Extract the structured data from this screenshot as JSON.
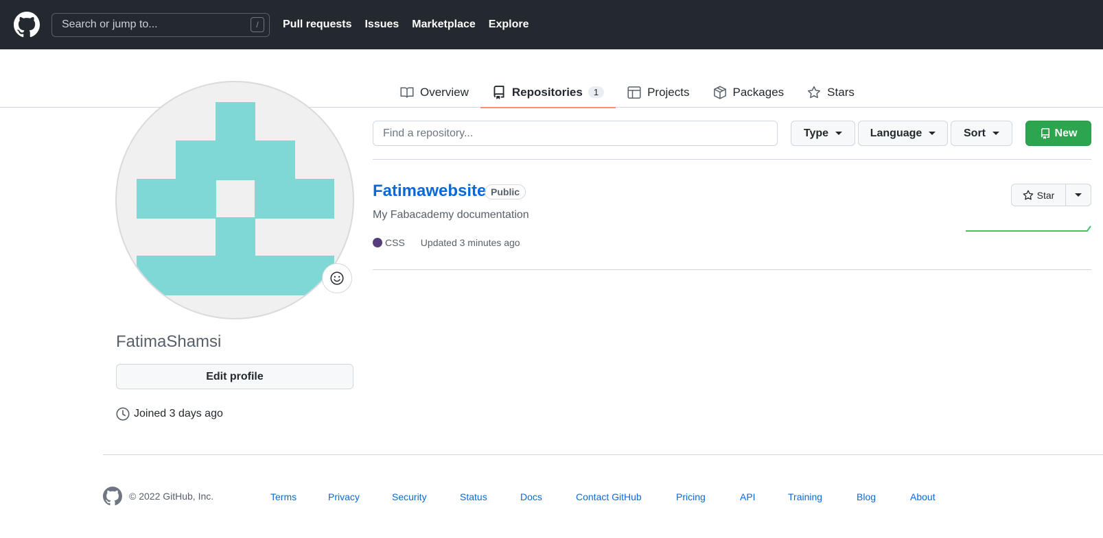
{
  "header": {
    "search_placeholder": "Search or jump to...",
    "search_shortcut": "/",
    "nav": [
      "Pull requests",
      "Issues",
      "Marketplace",
      "Explore"
    ]
  },
  "tabs": [
    {
      "label": "Overview",
      "icon": "book-icon"
    },
    {
      "label": "Repositories",
      "icon": "repo-icon",
      "count": "1",
      "active": true
    },
    {
      "label": "Projects",
      "icon": "table-icon"
    },
    {
      "label": "Packages",
      "icon": "package-icon"
    },
    {
      "label": "Stars",
      "icon": "star-icon"
    }
  ],
  "profile": {
    "username": "FatimaShamsi",
    "edit_label": "Edit profile",
    "joined": "Joined 3 days ago",
    "avatar_color": "#7fd8d4"
  },
  "filters": {
    "find_placeholder": "Find a repository...",
    "type_label": "Type",
    "language_label": "Language",
    "sort_label": "Sort",
    "new_label": "New"
  },
  "repo": {
    "name": "Fatimawebsite",
    "visibility": "Public",
    "description": "My Fabacademy documentation",
    "language": "CSS",
    "language_color": "#563d7c",
    "updated": "Updated 3 minutes ago",
    "star_label": "Star"
  },
  "footer": {
    "copyright": "© 2022 GitHub, Inc.",
    "links": [
      "Terms",
      "Privacy",
      "Security",
      "Status",
      "Docs",
      "Contact GitHub",
      "Pricing",
      "API",
      "Training",
      "Blog",
      "About"
    ]
  }
}
